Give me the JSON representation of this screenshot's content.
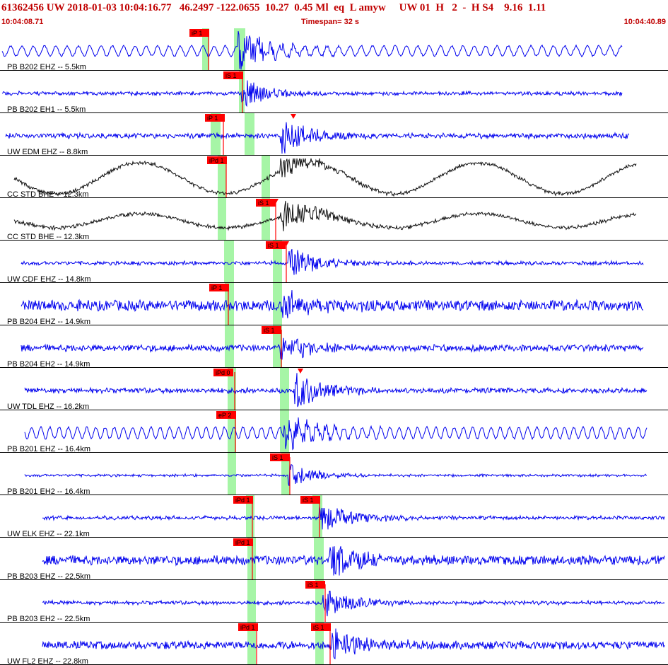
{
  "header": {
    "title": "61362456 UW 2018-01-03 10:04:16.77   46.2497 -122.0655  10.27  0.45 Ml  eq  L amyw     UW 01  H   2  -  H S4    9.16  1.11",
    "start_time": "10:04:08.71",
    "timespan": "Timespan=  32 s",
    "end_time": "10:04:40.89"
  },
  "colors": {
    "header_text": "#c00000",
    "trace_blue": "#0000ee",
    "trace_black": "#111111",
    "pick_red": "#ff0000",
    "window_green": "#a6f5a6"
  },
  "traces": [
    {
      "label": "PB B202 EHZ -- 5.5km",
      "picks": [
        "iP 1"
      ]
    },
    {
      "label": "PB B202 EH1 -- 5.5km",
      "picks": [
        "iS 1"
      ]
    },
    {
      "label": "UW EDM EHZ -- 8.8km",
      "picks": [
        "iP 1"
      ]
    },
    {
      "label": "CC STD BHZ -- 12.3km",
      "picks": [
        "iPd 1"
      ]
    },
    {
      "label": "CC STD BHE -- 12.3km",
      "picks": [
        "iS 1"
      ]
    },
    {
      "label": "UW CDF EHZ -- 14.8km",
      "picks": [
        "iS 1"
      ]
    },
    {
      "label": "PB B204 EHZ -- 14.9km",
      "picks": [
        "iP 1"
      ]
    },
    {
      "label": "PB B204 EH2 -- 14.9km",
      "picks": [
        "iS 1"
      ]
    },
    {
      "label": "UW TDL EHZ -- 16.2km",
      "picks": [
        "iPd 0"
      ]
    },
    {
      "label": "PB B201 EHZ -- 16.4km",
      "picks": [
        "eP 2"
      ]
    },
    {
      "label": "PB B201 EH2 -- 16.4km",
      "picks": [
        "iS 1"
      ]
    },
    {
      "label": "UW ELK EHZ -- 22.1km",
      "picks": [
        "iPd 1",
        "iS 1"
      ]
    },
    {
      "label": "PB B203 EHZ -- 22.5km",
      "picks": [
        "iPd 1"
      ]
    },
    {
      "label": "PB B203 EH2 -- 22.5km",
      "picks": [
        "iS 1"
      ]
    },
    {
      "label": "UW FL2 EHZ -- 22.8km",
      "picks": [
        "iPd 1",
        "iS 1"
      ]
    }
  ]
}
